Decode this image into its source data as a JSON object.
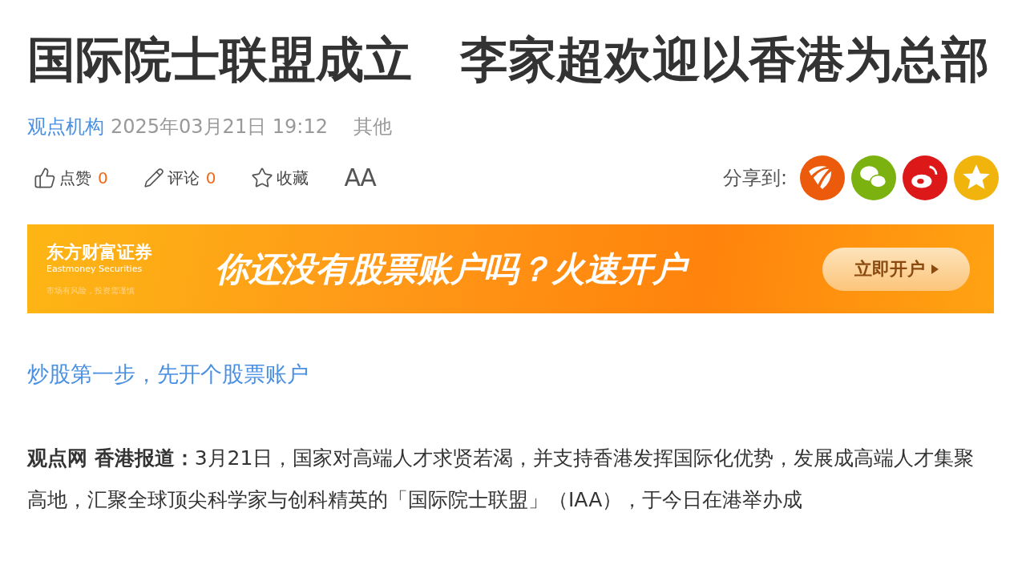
{
  "article": {
    "title": "国际院士联盟成立　李家超欢迎以香港为总部",
    "meta": {
      "source": "观点机构",
      "date": "2025年03月21日 19:12",
      "category": "其他"
    },
    "actions": [
      {
        "kind": "like",
        "label": "点赞",
        "count": "0"
      },
      {
        "kind": "comment",
        "label": "评论",
        "count": "0"
      },
      {
        "kind": "favorite",
        "label": "收藏"
      },
      {
        "kind": "font-size",
        "label": "AA"
      }
    ],
    "share": {
      "label": "分享到:",
      "targets": [
        {
          "kind": "eastmoney",
          "color": "#ec5a0c"
        },
        {
          "kind": "wechat",
          "color": "#7bb20f"
        },
        {
          "kind": "weibo",
          "color": "#dc1818"
        },
        {
          "kind": "qzone",
          "color": "#f0b40c"
        }
      ]
    },
    "banner": {
      "brand": "东方财富证券",
      "brand_en": "Eastmoney Securities",
      "disclaimer": "市场有风险，投资需谨慎",
      "slogan": "你还没有股票账户吗？火速开户",
      "button": "立即开户"
    },
    "promo_link": "炒股第一步，先开个股票账户",
    "paragraphs": [
      "**观点网 香港报道：**3月21日，国家对高端人才求贤若渴，并支持香港发挥国际化优势，发展成高端人才集聚高地，汇聚全球顶尖科学家与创科精英的「国际院士联盟」（IAA），于今日在港举办成"
    ]
  }
}
